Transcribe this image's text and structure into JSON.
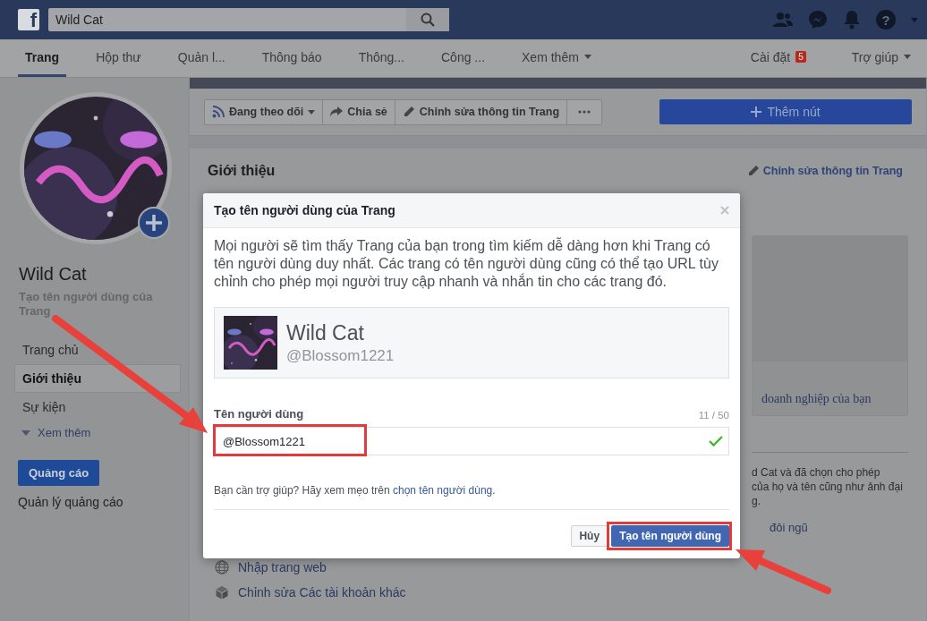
{
  "topbar": {
    "logo": "f",
    "search": {
      "value": "Wild Cat"
    },
    "help": "?"
  },
  "nav": {
    "tabs": [
      {
        "label": "Trang",
        "selected": true
      },
      {
        "label": "Hộp thư",
        "selected": false
      },
      {
        "label": "Quản l...",
        "selected": false
      },
      {
        "label": "Thông báo",
        "selected": false
      },
      {
        "label": "Thông...",
        "selected": false
      },
      {
        "label": "Công ...",
        "selected": false
      },
      {
        "label": "Xem thêm",
        "selected": false,
        "dropdown": true
      }
    ],
    "settings": {
      "label": "Cài đặt",
      "badge": "5"
    },
    "help": {
      "label": "Trợ giúp",
      "dropdown": true
    }
  },
  "sidebar": {
    "page_name": "Wild Cat",
    "subtitle": "Tạo tên người dùng của Trang",
    "items": [
      {
        "label": "Trang chủ",
        "selected": false
      },
      {
        "label": "Giới thiệu",
        "selected": true
      },
      {
        "label": "Sự kiện",
        "selected": false
      }
    ],
    "more": "Xem thêm",
    "ads_button": "Quảng cáo",
    "ads_link": "Quản lý quảng cáo"
  },
  "actions": [
    {
      "kind": "follow",
      "label": "Đang theo dõi",
      "dropdown": true
    },
    {
      "kind": "share",
      "label": "Chia sẻ"
    },
    {
      "kind": "edit",
      "label": "Chỉnh sửa thông tin Trang"
    },
    {
      "kind": "more"
    }
  ],
  "add_button": "Thêm nút",
  "about": {
    "title": "Giới thiệu",
    "edit_link": "Chỉnh sửa thông tin Trang",
    "side_link": "doanh nghiệp của bạn",
    "side_lines": [
      "d Cat và đã chọn cho phép",
      "của họ và tên cũng như ảnh đại",
      "g."
    ],
    "side_team": "đôi ngũ",
    "links": [
      {
        "kind": "globe",
        "label": "Nhập trang web"
      },
      {
        "kind": "cube",
        "label": "Chỉnh sửa Các tài khoản khác"
      }
    ]
  },
  "dialog": {
    "title": "Tạo tên người dùng của Trang",
    "description": "Mọi người sẽ tìm thấy Trang của bạn trong tìm kiếm dễ dàng hơn khi Trang có tên người dùng duy nhất. Các trang có tên người dùng cũng có thể tạo URL tùy chỉnh cho phép mọi người truy cập nhanh và nhắn tin cho các trang đó.",
    "preview": {
      "name": "Wild Cat",
      "username": "@Blossom1221"
    },
    "field": {
      "label": "Tên người dùng",
      "counter": "11 / 50",
      "value": "@Blossom1221",
      "valid": true
    },
    "help_text": "Bạn cần trợ giúp? Hãy xem mẹo trên ",
    "help_link": "chọn tên người dùng",
    "help_end": ".",
    "cancel": "Hủy",
    "submit": "Tạo tên người dùng"
  }
}
